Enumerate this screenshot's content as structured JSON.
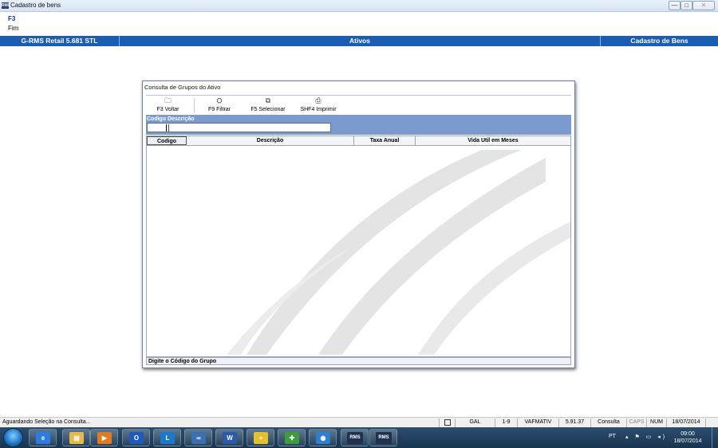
{
  "window": {
    "title": "Cadastro de bens",
    "app_icon_text": "RMS"
  },
  "window_controls": {
    "minimize": "—",
    "maximize": "□",
    "close": "✕"
  },
  "function_keys": {
    "key": "F3",
    "label": "Fim"
  },
  "header_strip": {
    "left": "G-RMS Retail 5.681 STL",
    "center": "Ativos",
    "right": "Cadastro de Bens"
  },
  "dialog": {
    "title": "Consulta de Grupos do Ativo",
    "toolbar": [
      {
        "label": "F3 Voltar",
        "icon": "back-folder-icon"
      },
      {
        "label": "F9 Filtrar",
        "icon": "binoculars-icon"
      },
      {
        "label": "F5 Selecionar",
        "icon": "select-icon"
      },
      {
        "label": "SHF4 Imprimir",
        "icon": "printer-icon"
      }
    ],
    "filter_label": "Codigo Descrição",
    "filter_value": "",
    "columns": [
      "Codigo",
      "Descrição",
      "Taxa Anual",
      "Vida Util em Meses"
    ],
    "rows": [],
    "status_text": "Digite o Código do Grupo"
  },
  "statusbar": {
    "message": "Aguardando Seleção na Consulta...",
    "p1": "GAL",
    "p2": "1-9",
    "p3": "VAFMATIV",
    "p4": "5.91.37",
    "p5": "Consulta",
    "caps": "CAPS",
    "num": "NUM",
    "date": "18/07/2014"
  },
  "taskbar": {
    "apps": [
      {
        "name": "internet-explorer",
        "glyph": "e",
        "color": "#2b7de0"
      },
      {
        "name": "file-explorer",
        "glyph": "▤",
        "color": "#e6b94a"
      },
      {
        "name": "media-player",
        "glyph": "▶",
        "color": "#e07b22"
      },
      {
        "name": "outlook",
        "glyph": "O",
        "color": "#1e5bb8"
      },
      {
        "name": "lync",
        "glyph": "L",
        "color": "#1e78c8"
      },
      {
        "name": "app-cd",
        "glyph": "∞",
        "color": "#3a6fb0"
      },
      {
        "name": "word",
        "glyph": "W",
        "color": "#2b5aa8"
      },
      {
        "name": "app-plus",
        "glyph": "+",
        "color": "#e3c02d"
      },
      {
        "name": "app-green",
        "glyph": "✚",
        "color": "#3f9c3a"
      },
      {
        "name": "app-globe",
        "glyph": "◉",
        "color": "#2f7fd0"
      },
      {
        "name": "rms-1",
        "glyph": "RMS",
        "color": "#20314f"
      },
      {
        "name": "rms-2",
        "glyph": "RMS",
        "color": "#20314f"
      }
    ],
    "language": "PT",
    "tray_icons": "▴ ⚑ ▭ ◂)",
    "time": "09:00",
    "date": "18/07/2014"
  }
}
